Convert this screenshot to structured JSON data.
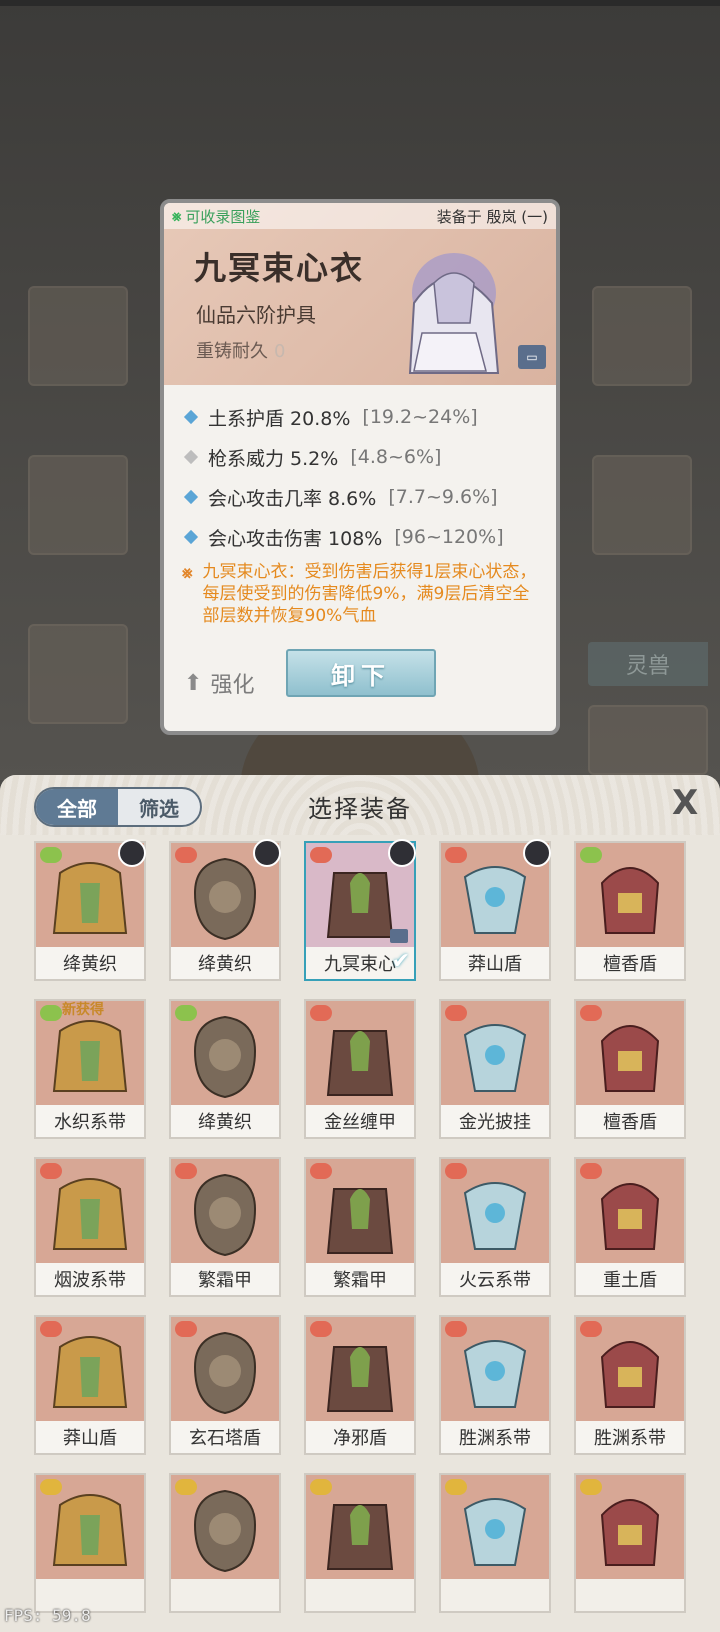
{
  "popup": {
    "collect_label": "可收录图鉴",
    "equipped_label": "装备于 殷岚 (一)",
    "name": "九冥束心衣",
    "grade": "仙品六阶护具",
    "reforge_label": "重铸耐久",
    "reforge_value": "0",
    "stats": [
      {
        "text": "土系护盾 20.8%",
        "range": "[19.2~24%]",
        "color": "blue"
      },
      {
        "text": "枪系威力 5.2%",
        "range": "[4.8~6%]",
        "color": "gray"
      },
      {
        "text": "会心攻击几率 8.6%",
        "range": "[7.7~9.6%]",
        "color": "blue"
      },
      {
        "text": "会心攻击伤害 108%",
        "range": "[96~120%]",
        "color": "blue"
      }
    ],
    "special": "九冥束心衣：受到伤害后获得1层束心状态，每层使受到的伤害降低9%，满9层后清空全部层数并恢复90%气血",
    "upgrade_label": "强化",
    "unequip_label": "卸下"
  },
  "background": {
    "tab_label": "灵兽"
  },
  "panel": {
    "tab_all": "全部",
    "tab_filter": "筛选",
    "title": "选择装备",
    "close": "X"
  },
  "items": [
    {
      "label": "绛黄织",
      "grade": "green",
      "avatar": true
    },
    {
      "label": "绛黄织",
      "grade": "red",
      "avatar": true
    },
    {
      "label": "九冥束心",
      "grade": "red",
      "avatar": true,
      "selected": true
    },
    {
      "label": "莽山盾",
      "grade": "red",
      "avatar": true
    },
    {
      "label": "檀香盾",
      "grade": "green"
    },
    {
      "label": "水织系带",
      "grade": "green",
      "new": "新获得"
    },
    {
      "label": "绛黄织",
      "grade": "green"
    },
    {
      "label": "金丝缠甲",
      "grade": "red"
    },
    {
      "label": "金光披挂",
      "grade": "red"
    },
    {
      "label": "檀香盾",
      "grade": "red"
    },
    {
      "label": "烟波系带",
      "grade": "red"
    },
    {
      "label": "繁霜甲",
      "grade": "red"
    },
    {
      "label": "繁霜甲",
      "grade": "red"
    },
    {
      "label": "火云系带",
      "grade": "red"
    },
    {
      "label": "重土盾",
      "grade": "red"
    },
    {
      "label": "莽山盾",
      "grade": "red"
    },
    {
      "label": "玄石塔盾",
      "grade": "red"
    },
    {
      "label": "净邪盾",
      "grade": "red"
    },
    {
      "label": "胜渊系带",
      "grade": "red"
    },
    {
      "label": "胜渊系带",
      "grade": "red"
    },
    {
      "label": "",
      "grade": "yellow"
    },
    {
      "label": "",
      "grade": "yellow"
    },
    {
      "label": "",
      "grade": "yellow"
    },
    {
      "label": "",
      "grade": "yellow"
    },
    {
      "label": "",
      "grade": "yellow"
    }
  ],
  "fps": "FPS: 59.8",
  "colors": {
    "accent": "#36a0b8",
    "special_text": "#e58a1f",
    "collect_green": "#3aa05c"
  }
}
